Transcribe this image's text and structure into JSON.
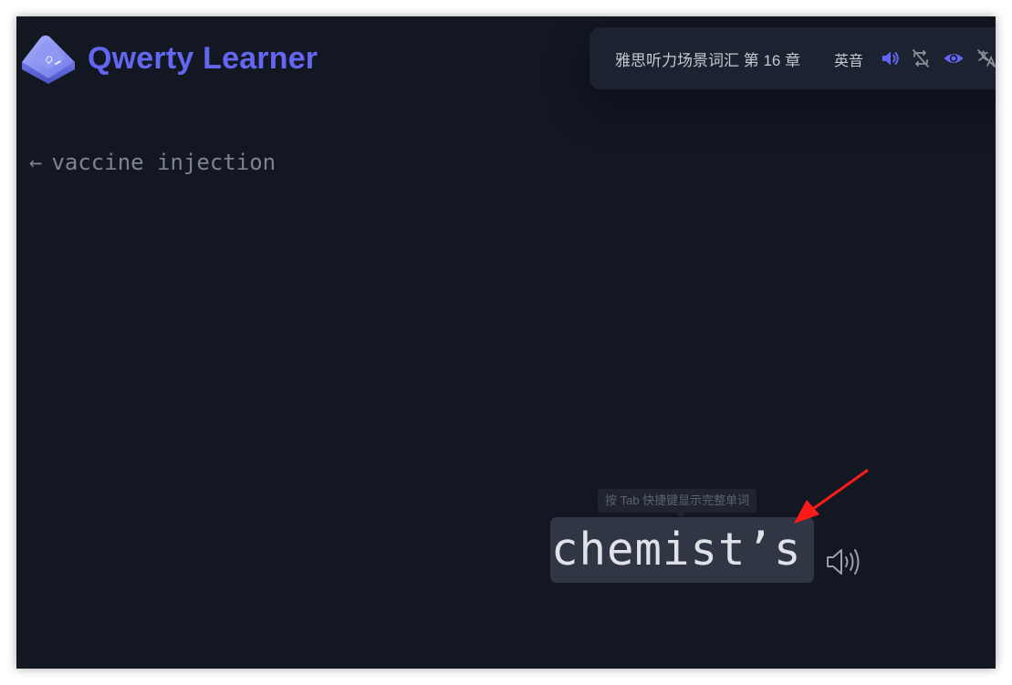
{
  "app": {
    "title": "Qwerty Learner",
    "brand_color": "#6366f1",
    "logo_key_letter": "Q"
  },
  "toolbar": {
    "dictionary_chapter": "雅思听力场景词汇 第 16 章",
    "accent": "英音",
    "icons": [
      "speaker-icon",
      "loop-off-icon",
      "eye-icon",
      "translation-off-icon"
    ],
    "active_icon_color": "#6366f1",
    "inactive_icon_color": "#8a8f9c"
  },
  "previous_word": {
    "arrow": "←",
    "text": "vaccine injection"
  },
  "current_word": {
    "text": "chemist’s",
    "tooltip": "按 Tab 快捷键显示完整单词"
  },
  "annotation": {
    "color": "#ff1a1a",
    "shape": "arrow"
  }
}
